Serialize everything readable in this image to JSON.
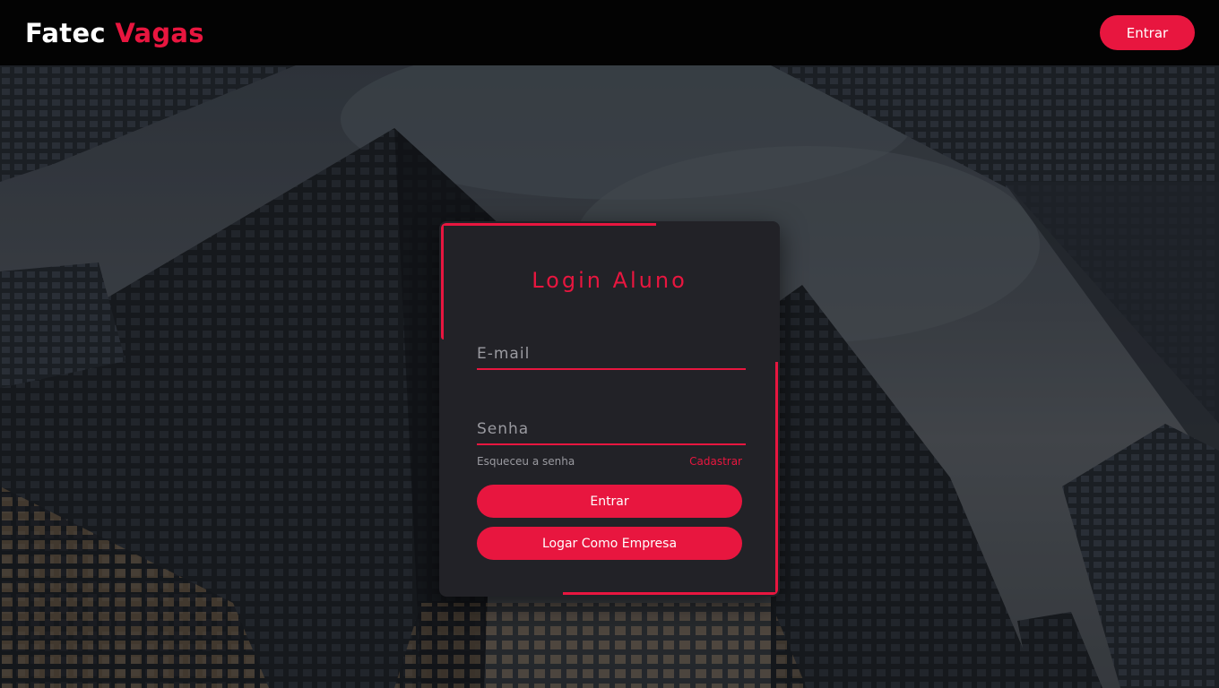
{
  "header": {
    "brand_main": "Fatec",
    "brand_accent": "Vagas",
    "login_button": "Entrar"
  },
  "login": {
    "title": "Login Aluno",
    "email_placeholder": "E-mail",
    "password_placeholder": "Senha",
    "forgot_link": "Esqueceu a senha",
    "signup_link": "Cadastrar",
    "submit_button": "Entrar",
    "company_button": "Logar Como Empresa"
  },
  "colors": {
    "accent": "#e8163f",
    "header_bg": "#030303",
    "card_bg": "#222227"
  }
}
